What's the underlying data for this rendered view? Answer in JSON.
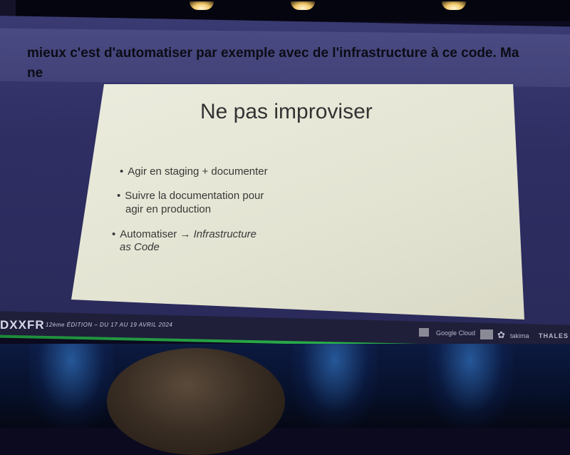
{
  "subtitles": {
    "line1": "mieux c'est d'automatiser par exemple avec de l'infrastructure à ce code. Ma",
    "line2": "ne"
  },
  "slide": {
    "title": "Ne pas improviser",
    "bullets": [
      {
        "line1": "Agir en staging + documenter",
        "line2": ""
      },
      {
        "line1": "Suivre la documentation pour",
        "line2": "agir en production"
      },
      {
        "line1": "Automatiser → ",
        "emph": "Infrastructure",
        "line2": "as Code"
      }
    ],
    "bullet_glyph": "•"
  },
  "footer": {
    "brand": "DXXFR",
    "edition": "12ème ÉDITION – DU 17 AU 19 AVRIL 2024",
    "sponsors": [
      "Google Cloud",
      "takima",
      "THALES"
    ]
  },
  "colors": {
    "screen": "#2f2e63",
    "slide_bg": "#e6e6d6",
    "footer_accent": "#28b049"
  }
}
